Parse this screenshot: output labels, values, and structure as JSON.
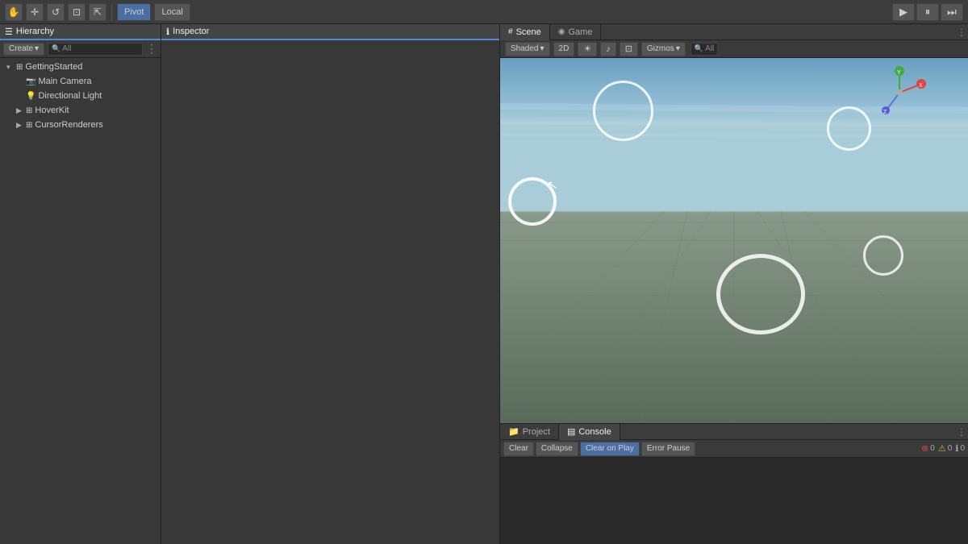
{
  "toolbar": {
    "pivot_label": "Pivot",
    "local_label": "Local",
    "play_icon": "▶",
    "pause_icon": "⏸",
    "step_icon": "⏭",
    "tools": [
      "✋",
      "+",
      "↺",
      "⊡",
      "⇱"
    ]
  },
  "hierarchy": {
    "tab_label": "Hierarchy",
    "create_label": "Create",
    "search_placeholder": "All",
    "scene_name": "GettingStarted",
    "items": [
      {
        "label": "Main Camera",
        "depth": 1
      },
      {
        "label": "Directional Light",
        "depth": 1
      },
      {
        "label": "HoverKit",
        "depth": 1,
        "has_children": true
      },
      {
        "label": "CursorRenderers",
        "depth": 1,
        "has_children": true
      }
    ]
  },
  "inspector": {
    "tab_label": "Inspector"
  },
  "scene": {
    "tab_label": "Scene",
    "game_tab_label": "Game",
    "shading_label": "Shaded",
    "mode_label": "2D",
    "gizmos_label": "Gizmos",
    "search_placeholder": "All"
  },
  "console": {
    "project_tab_label": "Project",
    "console_tab_label": "Console",
    "clear_label": "Clear",
    "collapse_label": "Collapse",
    "clear_on_play_label": "Clear on Play",
    "error_pause_label": "Error Pause",
    "error_count": "0",
    "warning_count": "0",
    "log_count": "0"
  }
}
